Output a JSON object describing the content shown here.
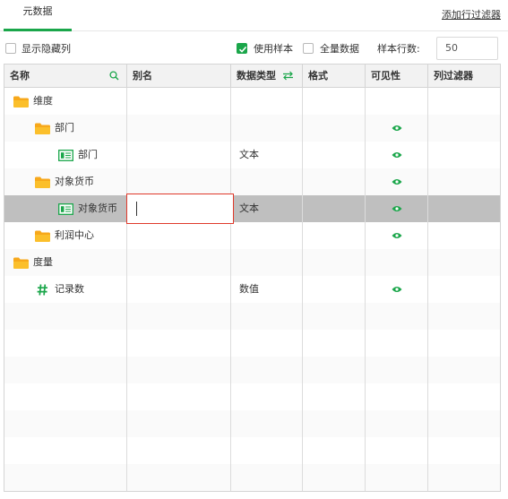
{
  "tabs": [
    {
      "label": "元数据"
    }
  ],
  "add_filter_label": "添加行过滤器",
  "toolbar": {
    "show_hidden_label": "显示隐藏列",
    "use_sample_label": "使用样本",
    "full_data_label": "全量数据",
    "sample_rows_label": "样本行数:",
    "sample_rows_value": "50"
  },
  "columns": [
    {
      "label": "名称"
    },
    {
      "label": "别名"
    },
    {
      "label": "数据类型"
    },
    {
      "label": "格式"
    },
    {
      "label": "可见性"
    },
    {
      "label": "列过滤器"
    }
  ],
  "rows": [
    {
      "name": "维度",
      "icon": "folder-icon",
      "type": "",
      "visible": false
    },
    {
      "name": "部门",
      "icon": "folder-icon",
      "type": "",
      "visible": true
    },
    {
      "name": "部门",
      "icon": "field-icon",
      "type": "文本",
      "visible": true
    },
    {
      "name": "对象货币",
      "icon": "folder-icon",
      "type": "",
      "visible": true
    },
    {
      "name": "对象货币",
      "icon": "field-icon",
      "type": "文本",
      "visible": true,
      "selected": true
    },
    {
      "name": "利润中心",
      "icon": "folder-icon",
      "type": "",
      "visible": true
    },
    {
      "name": "度量",
      "icon": "folder-icon",
      "type": "",
      "visible": false
    },
    {
      "name": "记录数",
      "icon": "hash-icon",
      "type": "数值",
      "visible": true
    }
  ],
  "colors": {
    "accent": "#1aa64a",
    "selected_row": "#bfbfbf",
    "edit_border": "#e0392b"
  }
}
